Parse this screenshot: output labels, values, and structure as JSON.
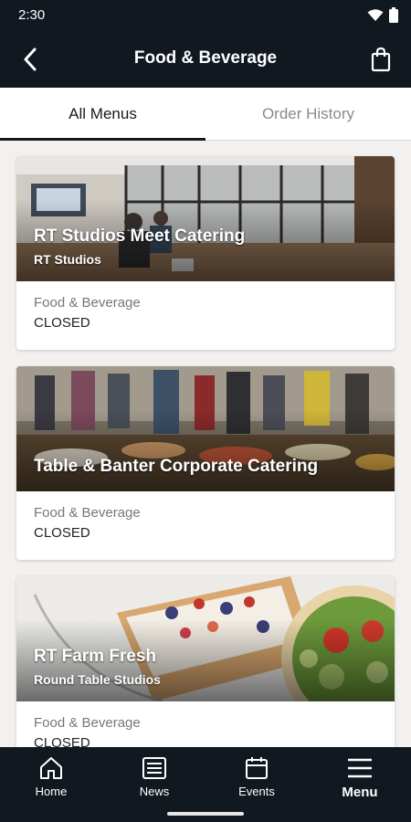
{
  "status_bar": {
    "time": "2:30"
  },
  "header": {
    "title": "Food & Beverage",
    "back_icon": "chevron-left-icon",
    "cart_icon": "shopping-bag-icon"
  },
  "tabs": [
    {
      "label": "All Menus",
      "active": true
    },
    {
      "label": "Order History",
      "active": false
    }
  ],
  "menus": [
    {
      "title": "RT Studios Meet Catering",
      "subtitle": "RT Studios",
      "category": "Food & Beverage",
      "status": "CLOSED"
    },
    {
      "title": "Table & Banter Corporate Catering",
      "subtitle": "",
      "category": "Food & Beverage",
      "status": "CLOSED"
    },
    {
      "title": "RT Farm Fresh",
      "subtitle": "Round Table Studios",
      "category": "Food & Beverage",
      "status": "CLOSED"
    }
  ],
  "bottom_nav": [
    {
      "label": "Home",
      "icon": "home-icon"
    },
    {
      "label": "News",
      "icon": "news-icon"
    },
    {
      "label": "Events",
      "icon": "calendar-icon"
    },
    {
      "label": "Menu",
      "icon": "hamburger-menu-icon"
    }
  ],
  "colors": {
    "bar": "#111820",
    "background": "#f2f1ef",
    "accent": "#111820"
  }
}
